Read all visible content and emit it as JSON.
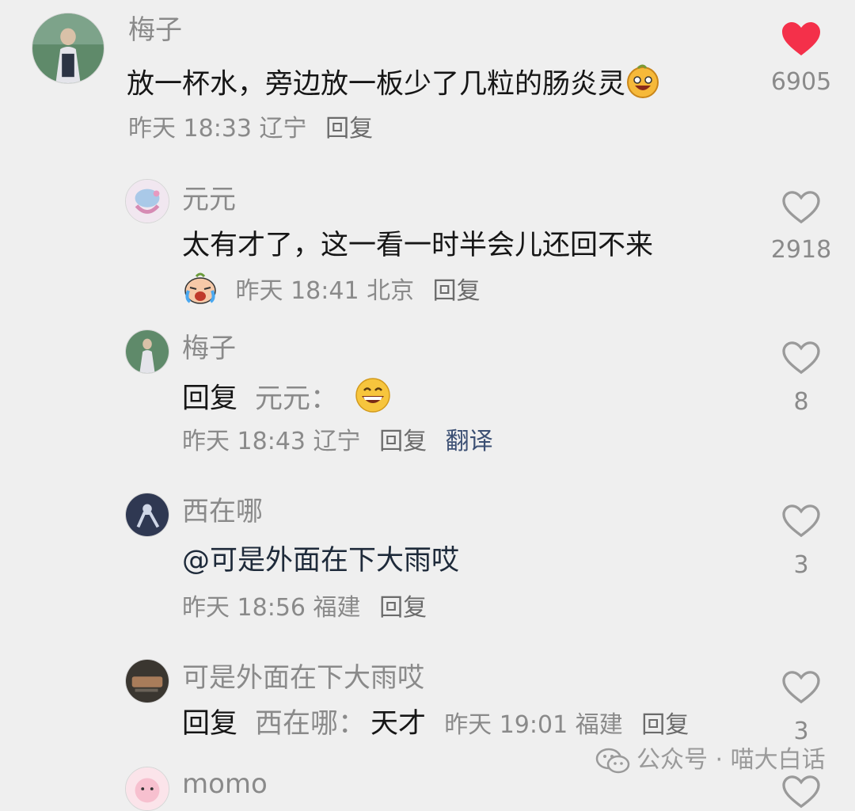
{
  "comments": [
    {
      "username": "梅子",
      "text": "放一杯水，旁边放一板少了几粒的肠炎灵",
      "time": "昨天 18:33",
      "location": "辽宁",
      "reply_label": "回复",
      "likes": "6905",
      "liked": true,
      "emoji": "grin-emoji"
    },
    {
      "username": "元元",
      "text": "太有才了，这一看一时半会儿还回不来",
      "time": "昨天 18:41",
      "location": "北京",
      "reply_label": "回复",
      "likes": "2918",
      "liked": false
    },
    {
      "username": "梅子",
      "reply_prefix": "回复",
      "reply_to": "元元：",
      "time": "昨天 18:43",
      "location": "辽宁",
      "reply_label": "回复",
      "translate_label": "翻译",
      "likes": "8",
      "liked": false,
      "emoji": "laugh-emoji"
    },
    {
      "username": "西在哪",
      "text": "@可是外面在下大雨哎",
      "time": "昨天 18:56",
      "location": "福建",
      "reply_label": "回复",
      "likes": "3",
      "liked": false
    },
    {
      "username": "可是外面在下大雨哎",
      "reply_prefix": "回复",
      "reply_to": "西在哪：",
      "text": "天才",
      "time": "昨天 19:01",
      "location": "福建",
      "reply_label": "回复",
      "likes": "3",
      "liked": false
    },
    {
      "username": "momo",
      "liked": false
    }
  ],
  "watermark": {
    "text": "公众号 · 喵大白话"
  },
  "colors": {
    "background": "#efefef",
    "like_red": "#f4304a",
    "muted_text": "#8a8a8a",
    "translate_blue": "#3b4f73"
  }
}
